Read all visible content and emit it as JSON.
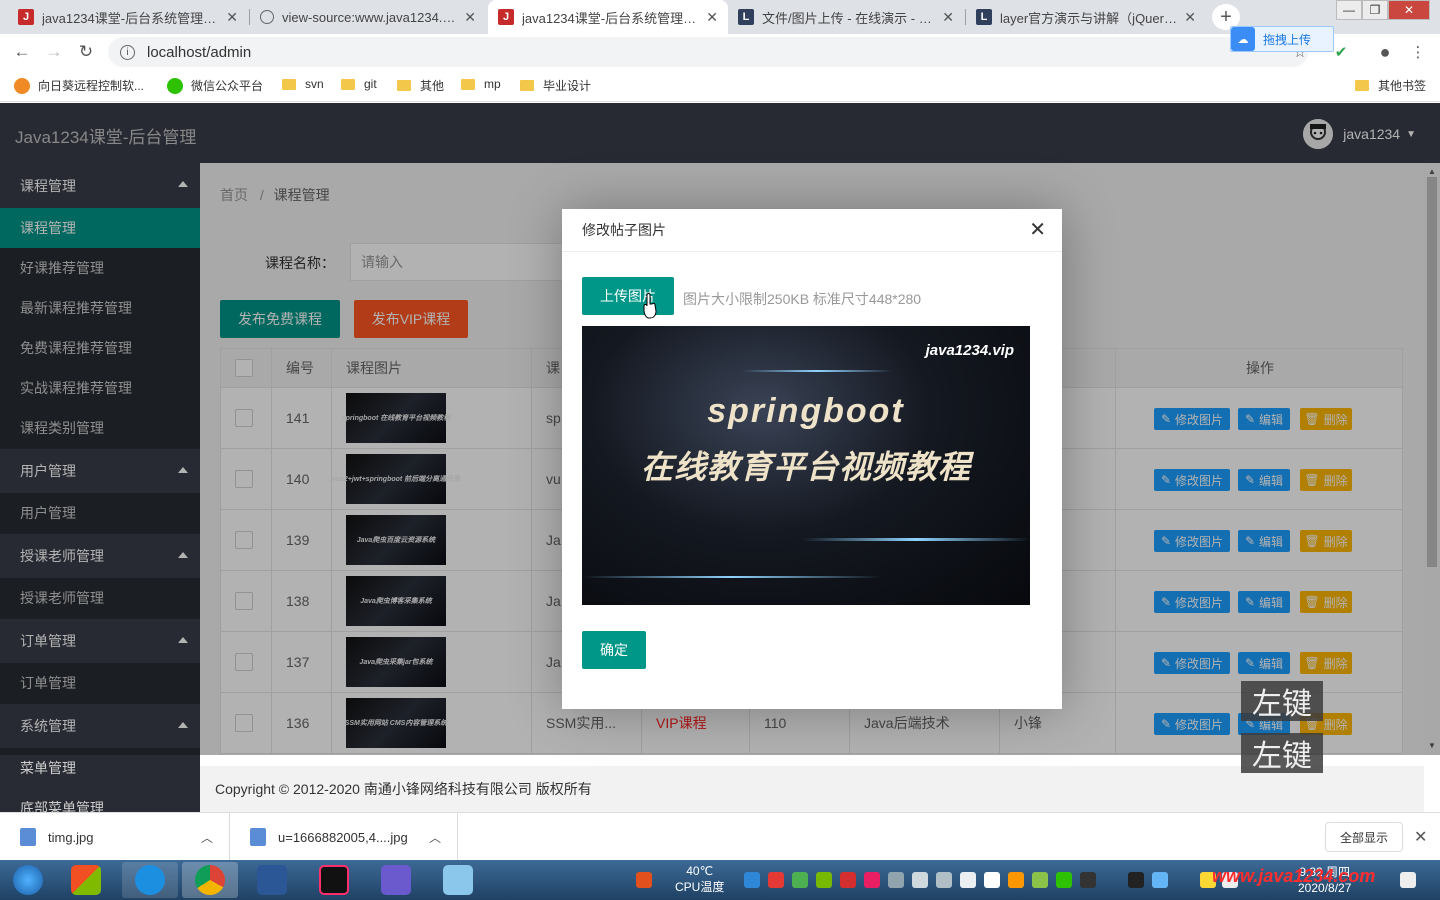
{
  "browser": {
    "tabs": [
      {
        "title": "java1234课堂-后台系统管理页面",
        "icon_letter": "J"
      },
      {
        "title": "view-source:www.java1234.vip",
        "icon_letter": ""
      },
      {
        "title": "java1234课堂-后台系统管理页面",
        "icon_letter": "J"
      },
      {
        "title": "文件/图片上传 - 在线演示 - Layui",
        "icon_letter": "L"
      },
      {
        "title": "layer官方演示与讲解（jQuery弹",
        "icon_letter": "L"
      }
    ],
    "url": "localhost/admin",
    "drag_upload": "拖拽上传",
    "bookmarks": [
      {
        "label": "向日葵远程控制软..."
      },
      {
        "label": "微信公众平台"
      },
      {
        "label": "svn"
      },
      {
        "label": "git"
      },
      {
        "label": "其他"
      },
      {
        "label": "mp"
      },
      {
        "label": "毕业设计"
      }
    ],
    "other_bookmarks": "其他书签"
  },
  "admin": {
    "brand": "Java1234课堂-后台管理",
    "username": "java1234"
  },
  "sidebar": {
    "groups": [
      {
        "label": "课程管理",
        "items": [
          "课程管理",
          "好课推荐管理",
          "最新课程推荐管理",
          "免费课程推荐管理",
          "实战课程推荐管理",
          "课程类别管理"
        ]
      },
      {
        "label": "用户管理",
        "items": [
          "用户管理"
        ]
      },
      {
        "label": "授课老师管理",
        "items": [
          "授课老师管理"
        ]
      },
      {
        "label": "订单管理",
        "items": [
          "订单管理"
        ]
      },
      {
        "label": "系统管理",
        "items": [
          "菜单管理",
          "底部菜单管理"
        ]
      }
    ]
  },
  "main": {
    "breadcrumb": {
      "home": "首页",
      "sep": "/",
      "current": "课程管理"
    },
    "search_label": "课程名称：",
    "search_placeholder": "请输入",
    "btn_free": "发布免费课程",
    "btn_vip": "发布VIP课程",
    "columns": [
      "编号",
      "课程图片",
      "课",
      "师",
      "操作"
    ],
    "rows": [
      {
        "id": "141",
        "img_text": "springboot 在线教育平台视频教程",
        "name": "sp"
      },
      {
        "id": "140",
        "img_text": "vue2+jwt+springboot 前后端分离通讯录",
        "name": "vu"
      },
      {
        "id": "139",
        "img_text": "Java爬虫百度云资源系统",
        "name": "Ja"
      },
      {
        "id": "138",
        "img_text": "Java爬虫博客采集系统",
        "name": "Ja"
      },
      {
        "id": "137",
        "img_text": "Java爬虫采集jar包系统",
        "name": "Ja"
      },
      {
        "id": "136",
        "img_text": "SSM实用网站 CMS内容管理系统",
        "name": "SSM实用...",
        "type": "VIP课程",
        "price": "110",
        "category": "Java后端技术",
        "teacher": "小锋"
      }
    ],
    "op_labels": {
      "edit_img": "修改图片",
      "edit": "编辑",
      "delete": "删除"
    }
  },
  "footer": "Copyright © 2012-2020 南通小锋网络科技有限公司 版权所有",
  "modal": {
    "title": "修改帖子图片",
    "upload_btn": "上传图片",
    "hint": "图片大小限制250KB 标准尺寸448*280",
    "image": {
      "watermark": "java1234.vip",
      "line1": "springboot",
      "line2": "在线教育平台视频教程"
    },
    "ok_btn": "确定"
  },
  "key_hints": [
    "左键",
    "左键"
  ],
  "downloads": [
    {
      "name": "timg.jpg"
    },
    {
      "name": "u=1666882005,4....jpg"
    }
  ],
  "show_all": "全部显示",
  "taskbar": {
    "temp": "40℃",
    "temp_label": "CPU温度",
    "time": "9:32 周四",
    "date": "2020/8/27",
    "site_watermark": "www.java1234.com"
  }
}
